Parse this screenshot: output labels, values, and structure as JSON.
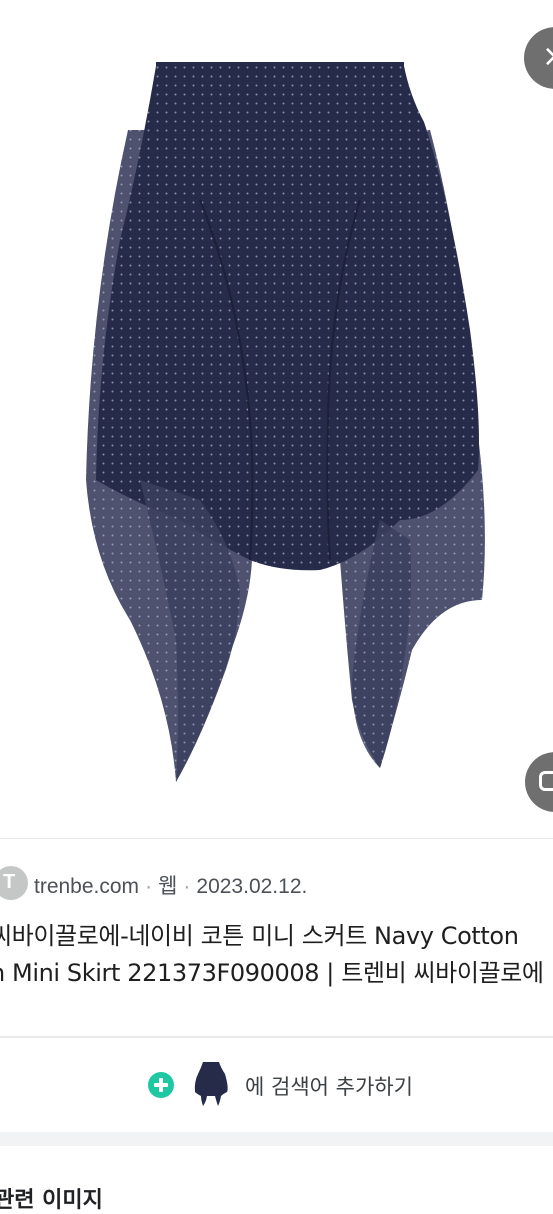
{
  "image": {
    "subject": "navy polka-dot chiffon mini skirt",
    "close_icon": "close-icon",
    "lens_icon": "lens-icon"
  },
  "source": {
    "favicon_letter": "T",
    "site": "trenbe.com",
    "type": "웹",
    "date": "2023.02.12."
  },
  "title": {
    "line1": "씨바이끌로에-네이비 코튼 미니 스커트 Navy Cotton",
    "line2": "n Mini Skirt 221373F090008 | 트렌비 씨바이끌로에"
  },
  "add_search": {
    "label": "에 검색어 추가하기",
    "icon": "plus-icon"
  },
  "related": {
    "heading": "관련 이미지"
  },
  "colors": {
    "accent_green": "#1ec8a0",
    "skirt_navy": "#262b49",
    "overlay_button": "#6f6f6f"
  }
}
